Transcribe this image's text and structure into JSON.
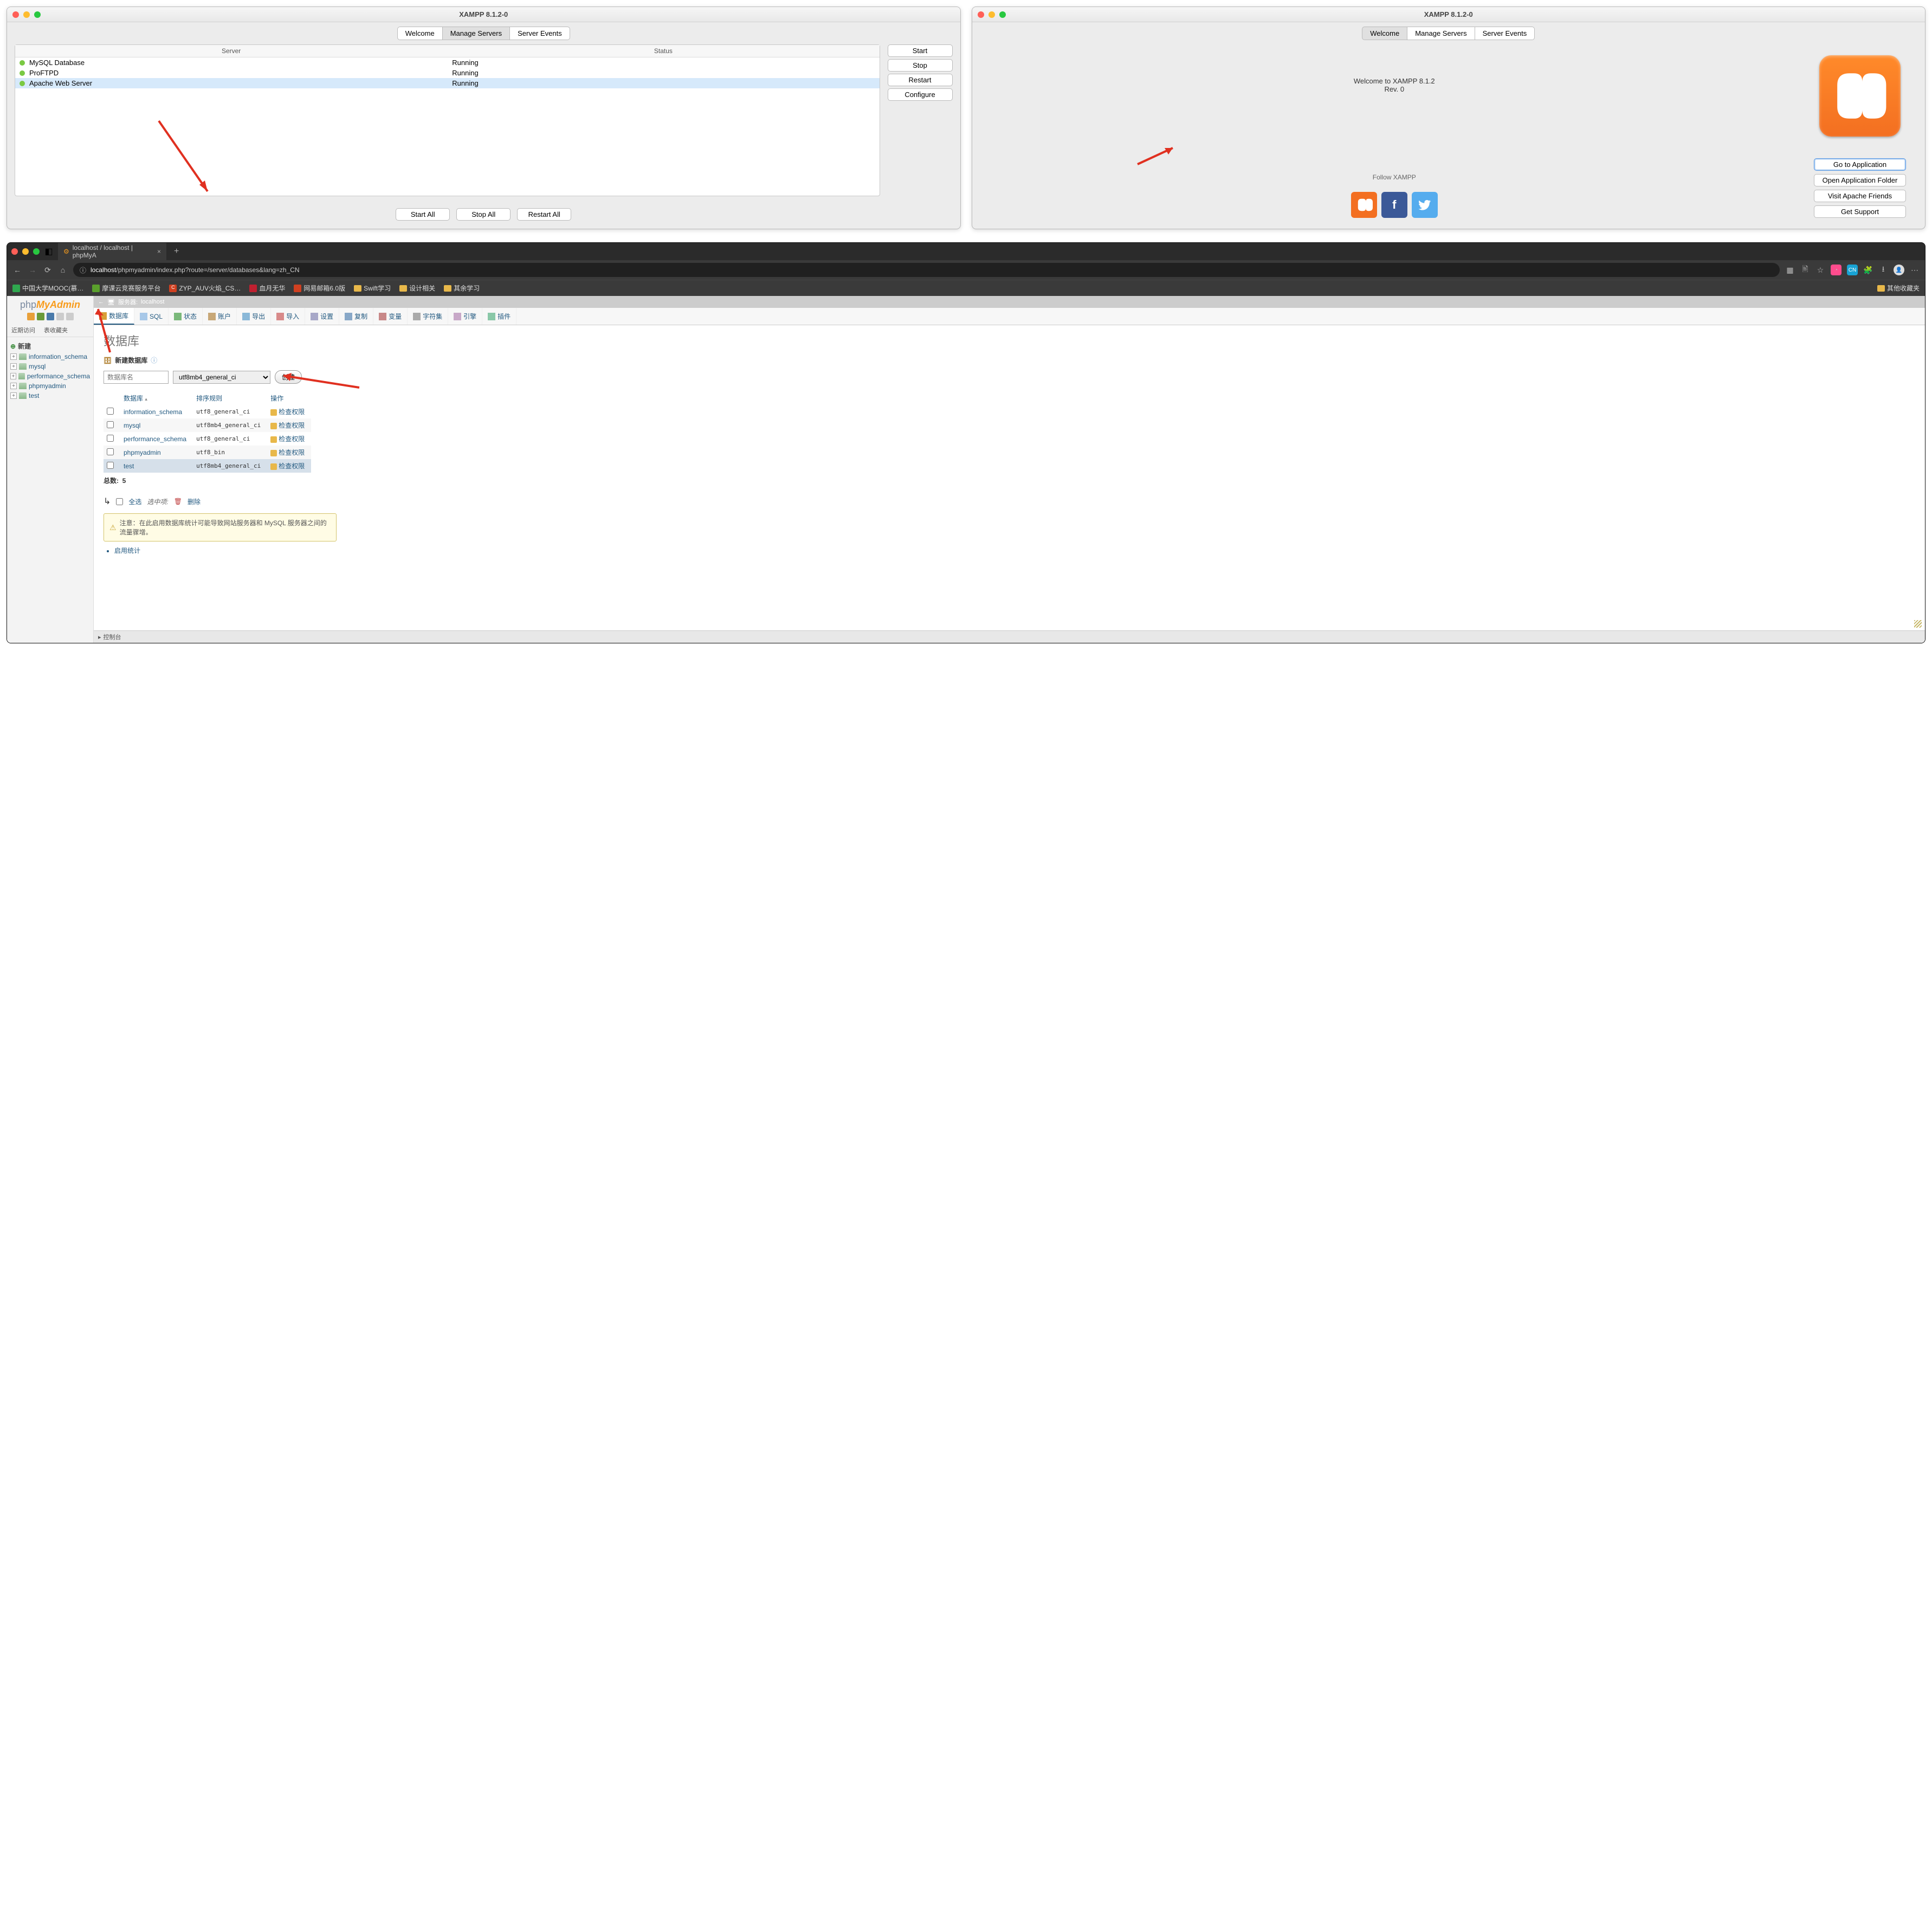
{
  "xampp_left": {
    "title": "XAMPP 8.1.2-0",
    "tabs": [
      "Welcome",
      "Manage Servers",
      "Server Events"
    ],
    "active_tab": 1,
    "columns": [
      "Server",
      "Status"
    ],
    "servers": [
      {
        "name": "MySQL Database",
        "status": "Running",
        "selected": false
      },
      {
        "name": "ProFTPD",
        "status": "Running",
        "selected": false
      },
      {
        "name": "Apache Web Server",
        "status": "Running",
        "selected": true
      }
    ],
    "side_buttons": [
      "Start",
      "Stop",
      "Restart",
      "Configure"
    ],
    "bottom_buttons": [
      "Start All",
      "Stop All",
      "Restart All"
    ]
  },
  "xampp_right": {
    "title": "XAMPP 8.1.2-0",
    "tabs": [
      "Welcome",
      "Manage Servers",
      "Server Events"
    ],
    "active_tab": 0,
    "welcome_line1": "Welcome to XAMPP 8.1.2",
    "welcome_line2": "Rev. 0",
    "follow": "Follow   XAMPP",
    "buttons": [
      "Go to Application",
      "Open Application Folder",
      "Visit Apache Friends",
      "Get Support"
    ]
  },
  "browser": {
    "tab_title": "localhost / localhost | phpMyA",
    "url_prefix": "localhost",
    "url_rest": "/phpmyadmin/index.php?route=/server/databases&lang=zh_CN",
    "bookmarks": [
      "中国大学MOOC(慕…",
      "摩课云竞赛服务平台",
      "ZYP_AUV火焰_CS…",
      "血月无华",
      "网易邮箱6.0版",
      "Swift学习",
      "设计相关",
      "其余学习"
    ],
    "other_bookmarks": "其他收藏夹"
  },
  "pma": {
    "logo1": "php",
    "logo2": "MyAdmin",
    "side_tabs": [
      "近期访问",
      "表收藏夹"
    ],
    "tree_new": "新建",
    "tree_dbs": [
      "information_schema",
      "mysql",
      "performance_schema",
      "phpmyadmin",
      "test"
    ],
    "server_label": "服务器:",
    "server_name": "localhost",
    "nav_tabs": [
      "数据库",
      "SQL",
      "状态",
      "账户",
      "导出",
      "导入",
      "设置",
      "复制",
      "变量",
      "字符集",
      "引擎",
      "插件"
    ],
    "heading": "数据库",
    "subhead": "新建数据库",
    "dbname_placeholder": "数据库名",
    "collation_selected": "utf8mb4_general_ci",
    "create_btn": "创建",
    "table_headers": [
      "数据库",
      "排序规则",
      "操作"
    ],
    "action_label": "检查权限",
    "rows": [
      {
        "name": "information_schema",
        "collation": "utf8_general_ci"
      },
      {
        "name": "mysql",
        "collation": "utf8mb4_general_ci"
      },
      {
        "name": "performance_schema",
        "collation": "utf8_general_ci"
      },
      {
        "name": "phpmyadmin",
        "collation": "utf8_bin"
      },
      {
        "name": "test",
        "collation": "utf8mb4_general_ci"
      }
    ],
    "total_label": "总数:",
    "total_value": "5",
    "check_all": "全选",
    "with_selected": "选中项:",
    "delete": "删除",
    "notice": "注意：在此启用数据库统计可能导致网站服务器和 MySQL 服务器之间的流量骤增。",
    "enable_stats": "启用统计",
    "footer": "控制台"
  }
}
